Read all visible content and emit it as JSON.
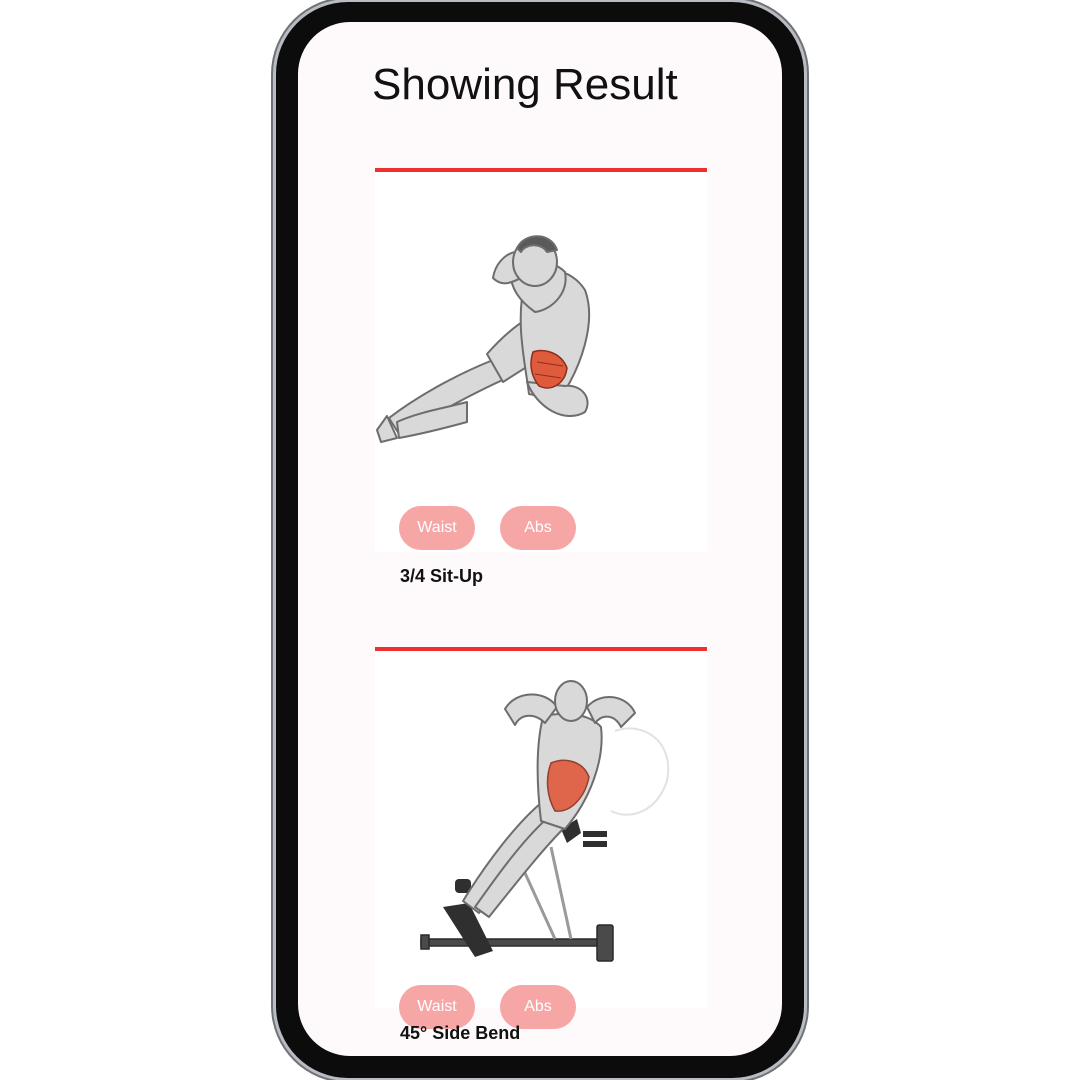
{
  "page": {
    "title": "Showing Result"
  },
  "results": [
    {
      "name": "3/4 Sit-Up",
      "illustration_icon": "sit-up-illustration-icon",
      "tags": [
        "Waist",
        "Abs"
      ]
    },
    {
      "name": "45° Side Bend",
      "illustration_icon": "side-bend-illustration-icon",
      "tags": [
        "Waist",
        "Abs"
      ]
    }
  ],
  "colors": {
    "accent_rule": "#f0302e",
    "tag_background": "#f7a6a6",
    "tag_text": "#ffffff",
    "screen_background": "#fefafb",
    "muscle_highlight": "#e05a3c"
  }
}
